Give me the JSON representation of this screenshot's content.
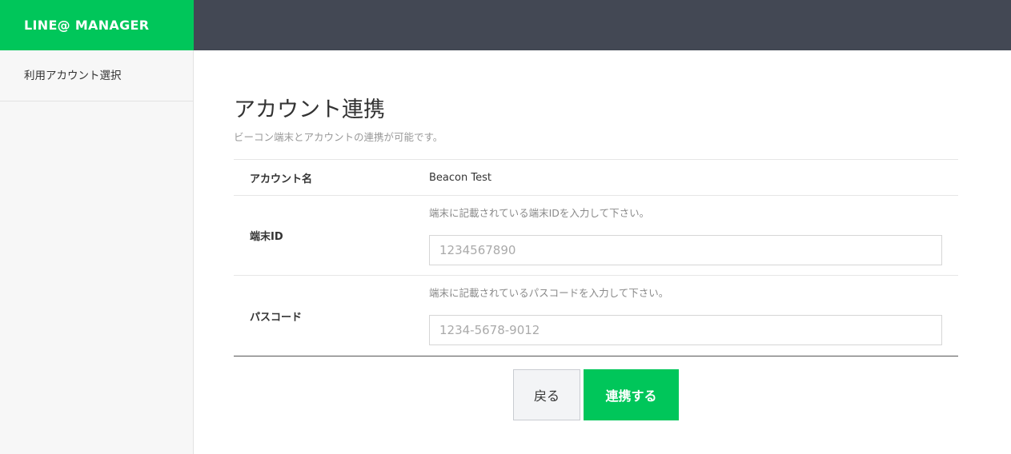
{
  "header": {
    "brand": "LINE@ MANAGER"
  },
  "sidebar": {
    "items": [
      {
        "label": "利用アカウント選択"
      }
    ]
  },
  "main": {
    "title": "アカウント連携",
    "subtitle": "ビーコン端末とアカウントの連携が可能です。",
    "form": {
      "account_name_label": "アカウント名",
      "account_name_value": "Beacon Test",
      "device_id_label": "端末ID",
      "device_id_hint": "端末に記載されている端末IDを入力して下さい。",
      "device_id_value": "",
      "device_id_placeholder": "1234567890",
      "passcode_label": "パスコード",
      "passcode_hint": "端末に記載されているパスコードを入力して下さい。",
      "passcode_value": "",
      "passcode_placeholder": "1234-5678-9012"
    },
    "actions": {
      "back_label": "戻る",
      "submit_label": "連携する"
    }
  },
  "colors": {
    "brand_green": "#00c65a",
    "topbar": "#434854",
    "sidebar_bg": "#f7f7f7"
  }
}
